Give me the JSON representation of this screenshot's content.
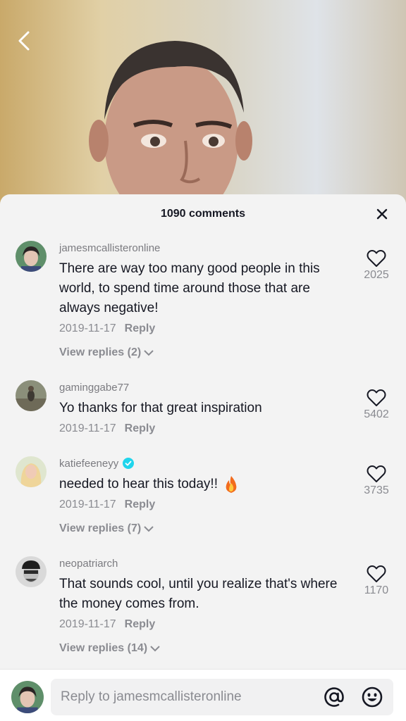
{
  "header": {
    "comments_count_label": "1090 comments"
  },
  "comments": [
    {
      "username": "jamesmcallisteronline",
      "text": "There are way too many good people in this world, to spend time around those that are always negative!",
      "date": "2019-11-17",
      "reply_label": "Reply",
      "view_replies_label": "View replies (2)",
      "likes": "2025",
      "verified": false
    },
    {
      "username": "gaminggabe77",
      "text": "Yo thanks for that great inspiration",
      "date": "2019-11-17",
      "reply_label": "Reply",
      "likes": "5402",
      "verified": false
    },
    {
      "username": "katiefeeneyy",
      "text": "needed to hear this today!!",
      "date": "2019-11-17",
      "reply_label": "Reply",
      "view_replies_label": "View replies (7)",
      "likes": "3735",
      "verified": true
    },
    {
      "username": "neopatriarch",
      "text": "That sounds cool, until you realize that's where the money comes from.",
      "date": "2019-11-17",
      "reply_label": "Reply",
      "view_replies_label": "View replies (14)",
      "likes": "1170",
      "verified": false
    }
  ],
  "reply_bar": {
    "placeholder": "Reply to jamesmcallisteronline"
  },
  "icons": {
    "back": "chevron-left-icon",
    "close": "close-icon",
    "heart": "heart-outline-icon",
    "verified": "verified-badge-icon",
    "fire": "fire-emoji",
    "mention": "at-sign-icon",
    "emoji": "smiley-icon"
  },
  "colors": {
    "text_primary": "#161823",
    "text_secondary": "#8a8b91",
    "verified_blue": "#20d5ec"
  }
}
